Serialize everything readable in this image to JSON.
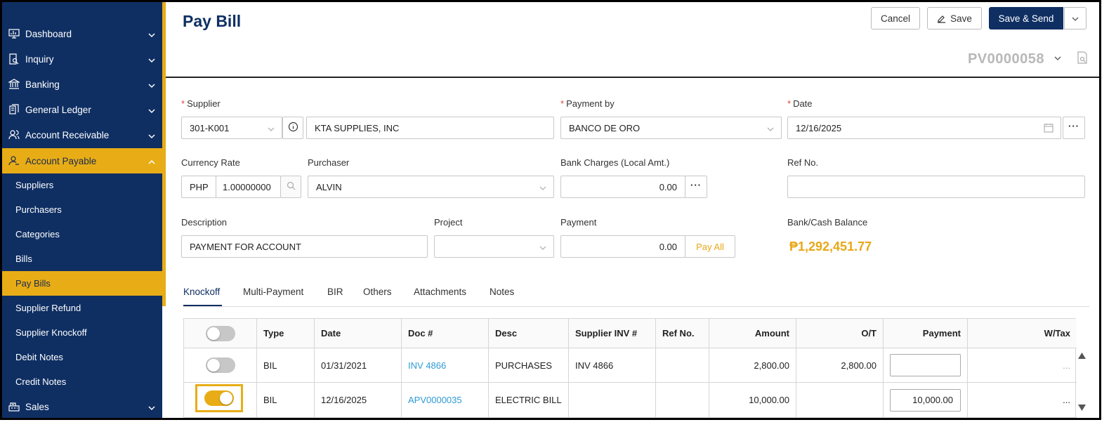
{
  "sidebar": {
    "items": [
      {
        "label": "Dashboard",
        "icon": "monitor-chart-icon"
      },
      {
        "label": "Inquiry",
        "icon": "document-search-icon"
      },
      {
        "label": "Banking",
        "icon": "bank-icon"
      },
      {
        "label": "General Ledger",
        "icon": "ledger-icon"
      },
      {
        "label": "Account Receivable",
        "icon": "users-icon"
      },
      {
        "label": "Account Payable",
        "icon": "user-icon"
      },
      {
        "label": "Sales",
        "icon": "register-icon"
      }
    ],
    "subitems": [
      "Suppliers",
      "Purchasers",
      "Categories",
      "Bills",
      "Pay Bills",
      "Supplier Refund",
      "Supplier Knockoff",
      "Debit Notes",
      "Credit Notes"
    ]
  },
  "header": {
    "title": "Pay Bill",
    "cancel_label": "Cancel",
    "save_label": "Save",
    "save_send_label": "Save & Send",
    "doc_number": "PV0000058"
  },
  "form": {
    "supplier_label": "Supplier",
    "supplier_code": "301-K001",
    "supplier_name": "KTA SUPPLIES, INC",
    "payment_by_label": "Payment by",
    "payment_by": "BANCO DE ORO",
    "date_label": "Date",
    "date": "12/16/2025",
    "currency_rate_label": "Currency Rate",
    "currency": "PHP",
    "rate": "1.00000000",
    "purchaser_label": "Purchaser",
    "purchaser": "ALVIN",
    "bank_charges_label": "Bank Charges (Local Amt.)",
    "bank_charges": "0.00",
    "ref_no_label": "Ref No.",
    "ref_no": "",
    "description_label": "Description",
    "description": "PAYMENT FOR ACCOUNT",
    "project_label": "Project",
    "project": "",
    "payment_label": "Payment",
    "payment": "0.00",
    "pay_all_label": "Pay All",
    "balance_label": "Bank/Cash Balance",
    "balance": "₱1,292,451.77"
  },
  "tabs": [
    "Knockoff",
    "Multi-Payment",
    "BIR",
    "Others",
    "Attachments",
    "Notes"
  ],
  "table": {
    "columns": [
      "Type",
      "Date",
      "Doc #",
      "Desc",
      "Supplier INV #",
      "Ref No.",
      "Amount",
      "O/T",
      "Payment",
      "W/Tax"
    ],
    "rows": [
      {
        "selected": false,
        "type": "BIL",
        "date": "01/31/2021",
        "doc": "INV 4866",
        "desc": "PURCHASES",
        "supplier_inv": "INV 4866",
        "ref": "",
        "amount": "2,800.00",
        "ot": "2,800.00",
        "payment": "",
        "wtax": "..."
      },
      {
        "selected": true,
        "type": "BIL",
        "date": "12/16/2025",
        "doc": "APV0000035",
        "desc": "ELECTRIC BILL",
        "supplier_inv": "",
        "ref": "",
        "amount": "10,000.00",
        "ot": "",
        "payment": "10,000.00",
        "wtax": "..."
      }
    ]
  },
  "colors": {
    "navy": "#0f2f63",
    "accent": "#e8ad16",
    "link": "#2e9ad7",
    "required": "#e0463d"
  }
}
